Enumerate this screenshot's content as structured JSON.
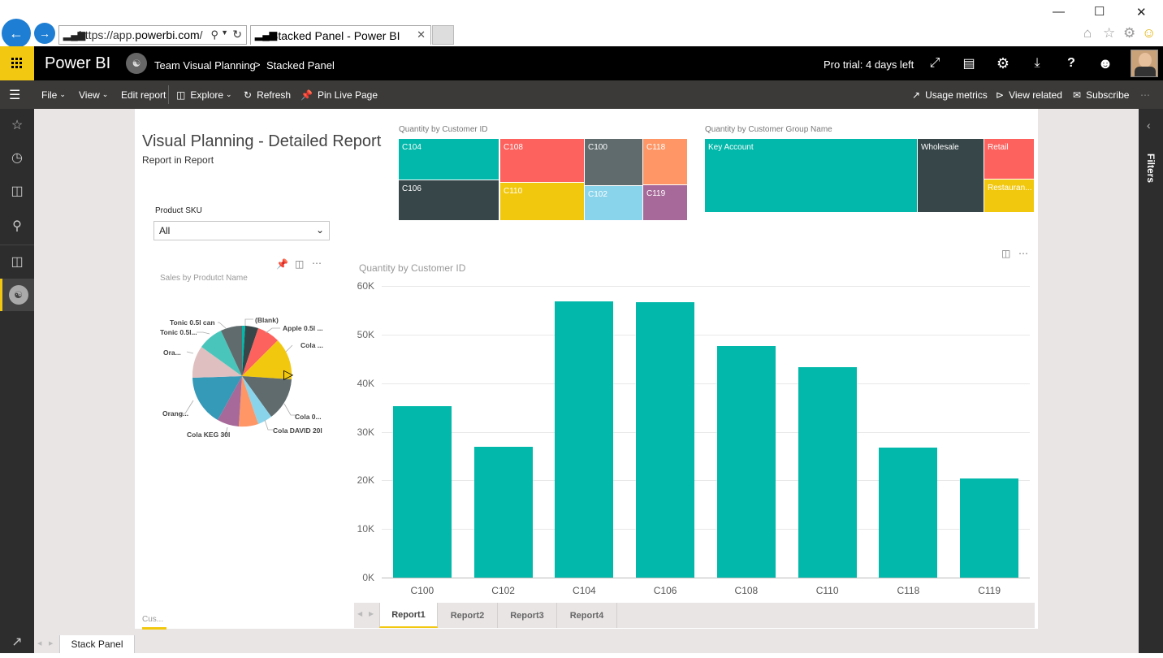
{
  "browser": {
    "url_prefix": "https://app.",
    "url_domain": "powerbi.com",
    "url_suffix": "/",
    "tab_title": "Stacked Panel - Power BI"
  },
  "header": {
    "app_name": "Power BI",
    "workspace": "Team Visual Planning",
    "separator": ">",
    "dashboard": "Stacked Panel",
    "trial": "Pro trial: 4 days left"
  },
  "toolbar": {
    "file": "File",
    "view": "View",
    "edit": "Edit report",
    "explore": "Explore",
    "refresh": "Refresh",
    "pin": "Pin Live Page",
    "usage": "Usage metrics",
    "related": "View related",
    "subscribe": "Subscribe"
  },
  "report": {
    "title": "Visual Planning - Detailed Report",
    "subtitle": "Report in Report",
    "slicer_label": "Product SKU",
    "slicer_value": "All",
    "pie_title": "Sales by Produtct Name",
    "tm1_title": "Quantity by Customer ID",
    "tm2_title": "Quantity by Customer Group Name",
    "bar_title": "Quantity by Customer ID",
    "cust_stub": "Cus..."
  },
  "treemap1": [
    {
      "label": "C104",
      "color": "#01b8aa"
    },
    {
      "label": "C106",
      "color": "#374649"
    },
    {
      "label": "C108",
      "color": "#fd625e"
    },
    {
      "label": "C110",
      "color": "#f2c80f"
    },
    {
      "label": "C100",
      "color": "#5f6b6d"
    },
    {
      "label": "C102",
      "color": "#8ad4eb"
    },
    {
      "label": "C118",
      "color": "#fe9666"
    },
    {
      "label": "C119",
      "color": "#a66999"
    }
  ],
  "treemap2": [
    {
      "label": "Key Account",
      "color": "#01b8aa"
    },
    {
      "label": "Wholesale",
      "color": "#374649"
    },
    {
      "label": "Retail",
      "color": "#fd625e"
    },
    {
      "label": "Restauran...",
      "color": "#f2c80f"
    }
  ],
  "pie_labels": [
    "(Blank)",
    "Apple 0.5l ...",
    "Cola ...",
    "Cola 0...",
    "Cola DAVID 20l",
    "Cola KEG 30l",
    "Orang...",
    "Ora...",
    "Tonic 0.5l...",
    "Tonic 0.5l can"
  ],
  "chart_data": {
    "type": "bar",
    "title": "Quantity by Customer ID",
    "categories": [
      "C100",
      "C102",
      "C104",
      "C106",
      "C108",
      "C110",
      "C118",
      "C119"
    ],
    "values": [
      35200,
      26900,
      56900,
      56700,
      47600,
      43300,
      26700,
      20400
    ],
    "ylim": [
      0,
      60000
    ],
    "yticks": [
      "0K",
      "10K",
      "20K",
      "30K",
      "40K",
      "50K",
      "60K"
    ],
    "grid": true,
    "color": "#01b8aa"
  },
  "report_tabs": [
    "Report1",
    "Report2",
    "Report3",
    "Report4"
  ],
  "bottom_tab": "Stack Panel",
  "filters_label": "Filters"
}
